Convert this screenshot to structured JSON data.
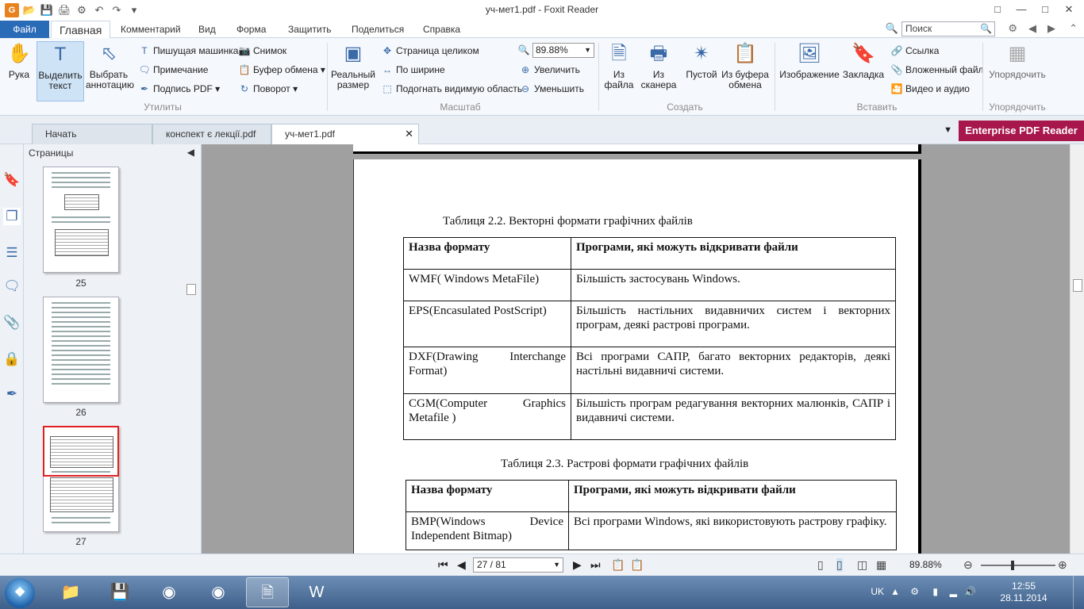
{
  "window": {
    "title": "уч-мет1.pdf - Foxit Reader"
  },
  "menu": {
    "file": "Файл",
    "tabs": [
      "Главная",
      "Комментарий",
      "Вид",
      "Форма",
      "Защитить",
      "Поделиться",
      "Справка"
    ],
    "search_placeholder": "Поиск"
  },
  "ribbon": {
    "hand": "Рука",
    "select_text": "Выделить текст",
    "select_annotation": "Выбрать аннотацию",
    "typewriter": "Пишущая машинка",
    "note": "Примечание",
    "sign_pdf": "Подпись PDF",
    "snapshot": "Снимок",
    "clipboard": "Буфер обмена",
    "rotate": "Поворот",
    "group_utilities": "Утилиты",
    "actual_size": "Реальный размер",
    "fit_page": "Страница целиком",
    "fit_width": "По ширине",
    "fit_visible": "Подогнать видимую область",
    "zoom_value": "89.88%",
    "zoom_in": "Увеличить",
    "zoom_out": "Уменьшить",
    "group_zoom": "Масштаб",
    "from_file": "Из файла",
    "from_scanner": "Из сканера",
    "blank": "Пустой",
    "from_clipboard": "Из буфера обмена",
    "group_create": "Создать",
    "image": "Изображение",
    "bookmark": "Закладка",
    "link": "Ссылка",
    "attachment": "Вложенный файл",
    "video_audio": "Видео и аудио",
    "group_insert": "Вставить",
    "arrange": "Упорядочить",
    "group_arrange": "Упорядочить"
  },
  "doctabs": [
    {
      "label": "Начать"
    },
    {
      "label": "конспект є лекції.pdf"
    },
    {
      "label": "уч-мет1.pdf"
    }
  ],
  "enterprise_label": "Enterprise PDF Reader",
  "pages_panel": {
    "header": "Страницы",
    "thumbs": [
      "25",
      "26",
      "27"
    ]
  },
  "document": {
    "caption1": "Таблиця 2.2. Векторні формати графічних файлів",
    "table1": {
      "header": [
        "Назва формату",
        "Програми, які можуть відкривати файли"
      ],
      "rows": [
        [
          "WMF( Windows MetaFile)",
          "Більшість застосувань Windows."
        ],
        [
          "EPS(Encasulated PostScript)",
          "Більшість настільних видавничих систем і векторних програм, деякі растрові програми."
        ],
        [
          "DXF(Drawing Interchange Format)",
          "Всі програми САПР, багато векторних редакторів, деякі настільні видавничі системи."
        ],
        [
          "CGM(Computer Graphics Metafile )",
          "Більшість програм редагування векторних малюнків, САПР і видавничі системи."
        ]
      ]
    },
    "caption2": "Таблиця 2.3. Растрові формати графічних файлів",
    "table2": {
      "header": [
        "Назва формату",
        "Програми, які можуть відкривати файли"
      ],
      "rows": [
        [
          "BMP(Windows Device Independent Bitmap)",
          "Всі програми Windows, які використовують растрову графіку."
        ]
      ]
    }
  },
  "statusbar": {
    "page_indicator": "27 / 81",
    "zoom": "89.88%"
  },
  "taskbar": {
    "lang": "UK",
    "time": "12:55",
    "date": "28.11.2014"
  },
  "colors": {
    "accent": "#2a6bb8",
    "enterprise": "#a8174b",
    "selection_border": "#e02020"
  }
}
